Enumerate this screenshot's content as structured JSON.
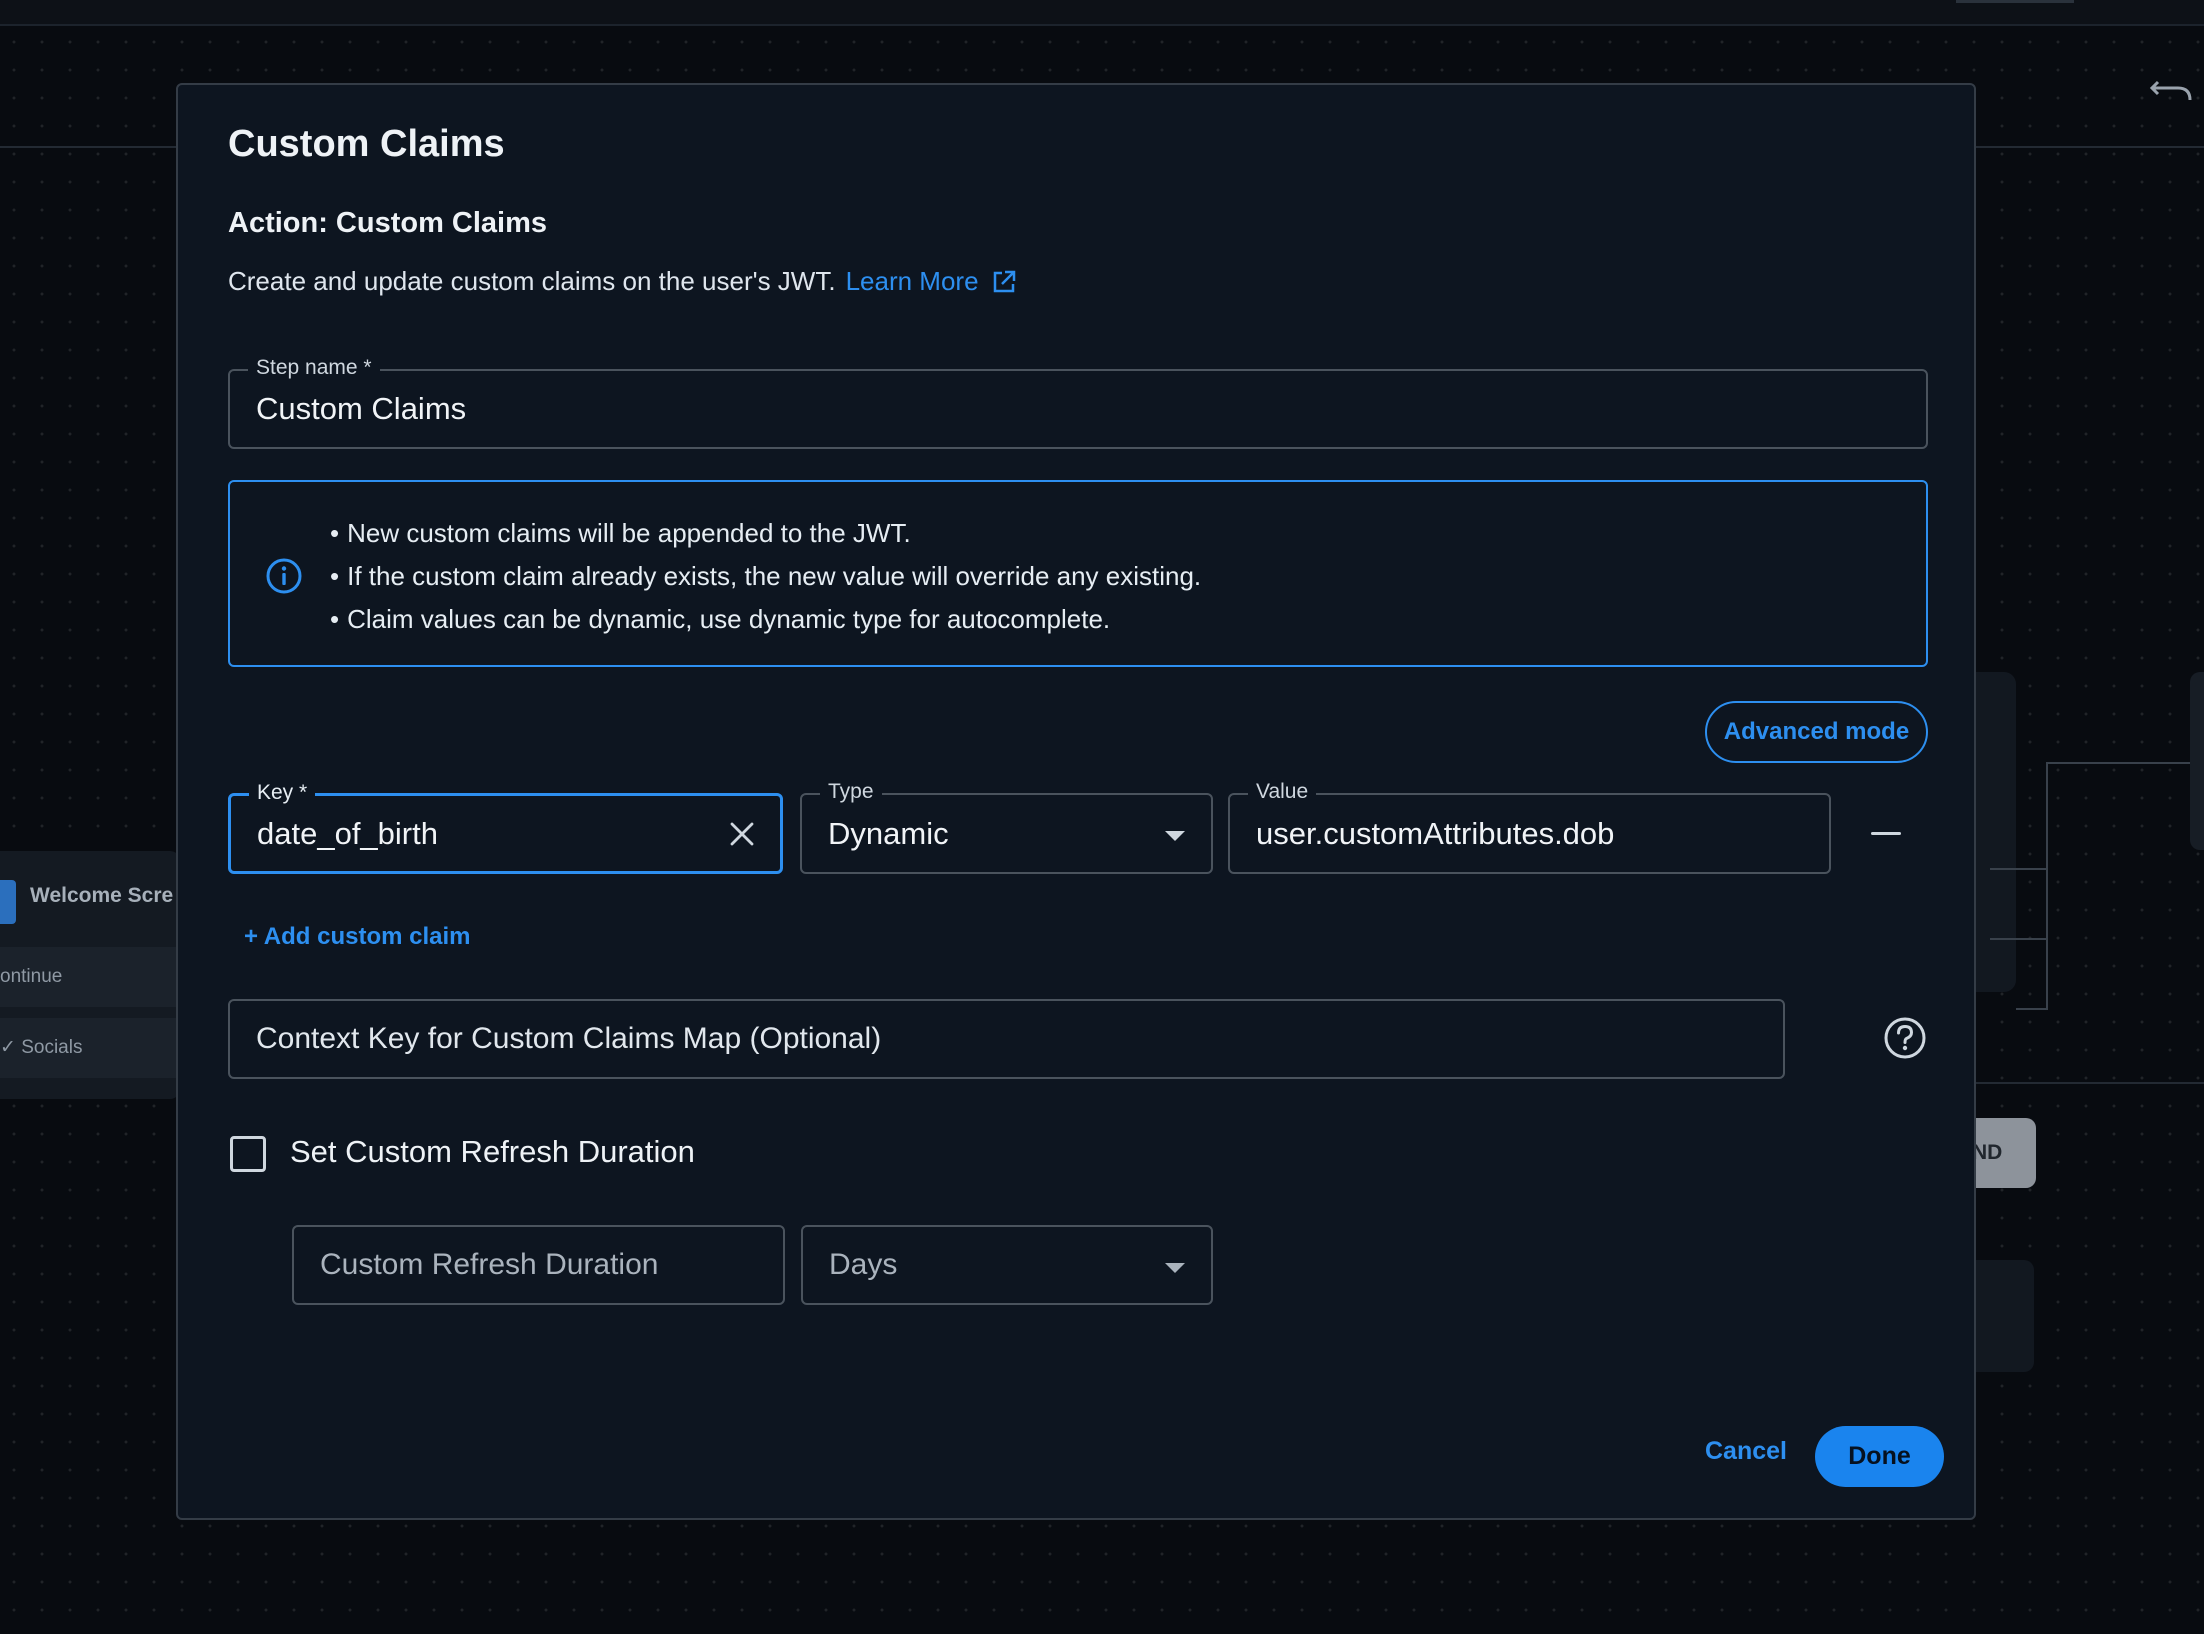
{
  "canvas": {
    "node_title": "Welcome Scre",
    "node_rows": [
      "ontinue",
      "✓ Socials"
    ],
    "end_button": "ND"
  },
  "modal": {
    "title": "Custom Claims",
    "action_title": "Action: Custom Claims",
    "description": "Create and update custom claims on the user's JWT.",
    "learn_more": "Learn More",
    "step_name": {
      "label": "Step name *",
      "value": "Custom Claims"
    },
    "info": {
      "icon": "info-icon",
      "items": [
        "New custom claims will be appended to the JWT.",
        "If the custom claim already exists, the new value will override any existing.",
        "Claim values can be dynamic, use dynamic type for autocomplete."
      ]
    },
    "advanced_mode_label": "Advanced mode",
    "claim": {
      "key_label": "Key *",
      "key_value": "date_of_birth",
      "type_label": "Type",
      "type_value": "Dynamic",
      "value_label": "Value",
      "value_value": "user.customAttributes.dob"
    },
    "add_claim_label": "+ Add custom claim",
    "context_key_placeholder": "Context Key for Custom Claims Map (Optional)",
    "refresh": {
      "checkbox_label": "Set Custom Refresh Duration",
      "checked": false,
      "duration_placeholder": "Custom Refresh Duration",
      "unit_value": "Days"
    },
    "cancel_label": "Cancel",
    "done_label": "Done",
    "colors": {
      "accent": "#2d8ff0",
      "background": "#0d1520",
      "border": "#4a535d"
    }
  }
}
